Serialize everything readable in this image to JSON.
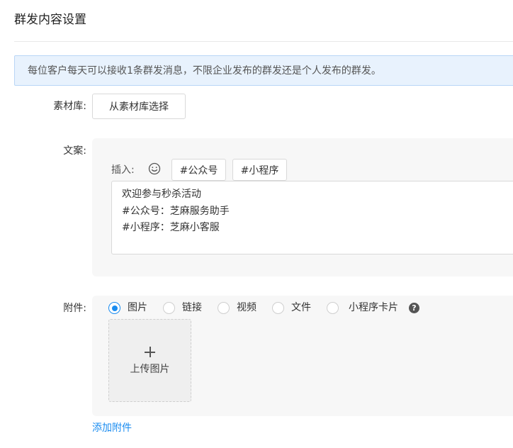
{
  "page": {
    "title": "群发内容设置"
  },
  "notice": {
    "text": "每位客户每天可以接收1条群发消息，不限企业发布的群发还是个人发布的群发。"
  },
  "material": {
    "label": "素材库:",
    "button": "从素材库选择"
  },
  "copy": {
    "label": "文案:",
    "insert_label": "插入:",
    "insert_buttons": [
      "#公众号",
      "#小程序"
    ],
    "content": "欢迎参与秒杀活动\n#公众号：芝麻服务助手\n#小程序：芝麻小客服"
  },
  "attachment": {
    "label": "附件:",
    "options": [
      {
        "label": "图片",
        "checked": true
      },
      {
        "label": "链接",
        "checked": false
      },
      {
        "label": "视频",
        "checked": false
      },
      {
        "label": "文件",
        "checked": false
      },
      {
        "label": "小程序卡片",
        "checked": false
      }
    ],
    "help": "?",
    "upload": {
      "icon": "plus-icon",
      "label": "上传图片"
    }
  },
  "add_attachment": {
    "label": "添加附件"
  },
  "colors": {
    "accent": "#1a8cf0",
    "notice_bg": "#e8f2fd",
    "panel_bg": "#f7f7f7"
  }
}
